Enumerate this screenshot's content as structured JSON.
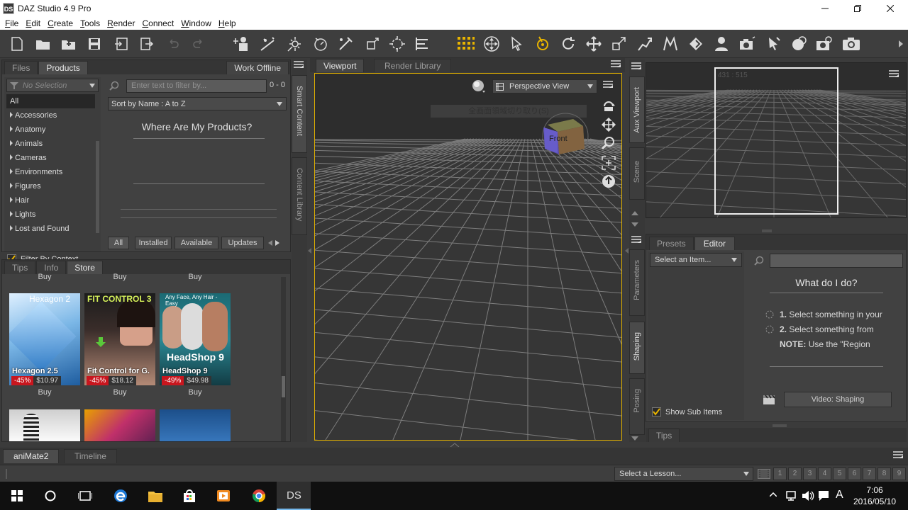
{
  "window": {
    "app_icon": "DS",
    "title": "DAZ Studio 4.9 Pro"
  },
  "menu": [
    "File",
    "Edit",
    "Create",
    "Tools",
    "Render",
    "Connect",
    "Window",
    "Help"
  ],
  "content_library": {
    "tabs": [
      "Files",
      "Products"
    ],
    "work_offline": "Work Offline",
    "selection_placeholder": "No Selection",
    "filter_placeholder": "Enter text to filter by...",
    "count": "0 - 0",
    "sort": "Sort by Name : A to Z",
    "categories": [
      "All",
      "Accessories",
      "Anatomy",
      "Animals",
      "Cameras",
      "Environments",
      "Figures",
      "Hair",
      "Lights",
      "Lost and Found"
    ],
    "filter_by_context": "Filter By Context",
    "heading": "Where Are My Products?",
    "bottom_tabs": [
      "All",
      "Installed",
      "Available",
      "Updates"
    ],
    "side_tabs": [
      "Smart Content",
      "Content Library"
    ]
  },
  "store": {
    "tabs": [
      "Tips",
      "Info",
      "Store"
    ],
    "buy_label": "Buy",
    "items": [
      {
        "name": "Hexagon 2.5",
        "discount": "-45%",
        "price": "$10.97",
        "banner": "Hexagon 2"
      },
      {
        "name": "Fit Control for G.",
        "discount": "-45%",
        "price": "$18.12",
        "banner": "FIT CONTROL 3"
      },
      {
        "name": "HeadShop 9",
        "discount": "-49%",
        "price": "$49.98",
        "banner": "Any Face, Any Hair - Easy",
        "banner2": "HeadShop 9"
      }
    ]
  },
  "viewport": {
    "tabs": [
      "Viewport",
      "Render Library"
    ],
    "camera": "Perspective View",
    "cube_label": "Front",
    "ghost_text": "全画面領域切り取り(S)"
  },
  "aux": {
    "coords": "431 : 515",
    "side_tabs": [
      "Aux Viewport",
      "Scene"
    ]
  },
  "parameters": {
    "tabs": [
      "Presets",
      "Editor"
    ],
    "select_item": "Select an Item...",
    "heading": "What do I do?",
    "steps": [
      {
        "num": "1.",
        "text": "Select something in your"
      },
      {
        "num": "2.",
        "text": "Select something from"
      }
    ],
    "note_label": "NOTE:",
    "note_text": "Use the \"Region",
    "show_sub_items": "Show Sub Items",
    "video_button": "Video: Shaping",
    "tips_tab": "Tips",
    "side_tabs": [
      "Parameters",
      "Shaping",
      "Posing"
    ]
  },
  "timeline": {
    "tabs": [
      "aniMate2",
      "Timeline"
    ],
    "lesson_placeholder": "Select a Lesson...",
    "pages": [
      "1",
      "2",
      "3",
      "4",
      "5",
      "6",
      "7",
      "8",
      "9"
    ]
  },
  "taskbar": {
    "time": "7:06",
    "date": "2016/05/10",
    "ime": "A",
    "active_app": "DS"
  },
  "colors": {
    "accent": "#f0b800",
    "panel": "#414141",
    "discount": "#c8161e"
  }
}
